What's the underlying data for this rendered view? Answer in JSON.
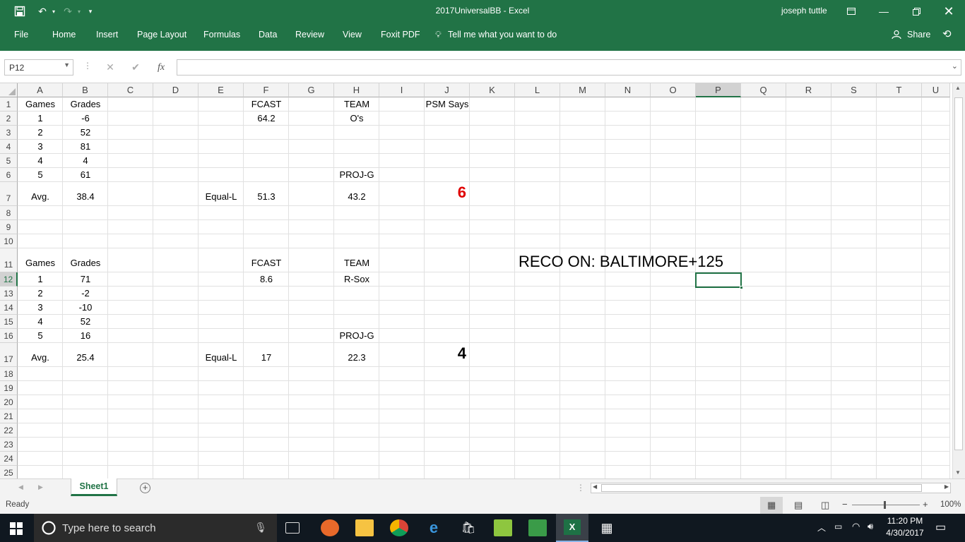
{
  "window": {
    "title": "2017UniversalBB  -  Excel",
    "user": "joseph tuttle"
  },
  "ribbon": {
    "tabs": [
      "File",
      "Home",
      "Insert",
      "Page Layout",
      "Formulas",
      "Data",
      "Review",
      "View",
      "Foxit PDF"
    ],
    "tell_me": "Tell me what you want to do",
    "share": "Share"
  },
  "formula_bar": {
    "name_box": "P12",
    "fx": "fx",
    "content": ""
  },
  "columns": [
    "A",
    "B",
    "C",
    "D",
    "E",
    "F",
    "G",
    "H",
    "I",
    "J",
    "K",
    "L",
    "M",
    "N",
    "O",
    "P",
    "Q",
    "R",
    "S",
    "T",
    "U"
  ],
  "rows": [
    "1",
    "2",
    "3",
    "4",
    "5",
    "6",
    "7",
    "8",
    "9",
    "10",
    "11",
    "12",
    "13",
    "14",
    "15",
    "16",
    "17",
    "18",
    "19",
    "20",
    "21",
    "22",
    "23",
    "24",
    "25"
  ],
  "cells": {
    "A1": "Games",
    "B1": "Grades",
    "F1": "FCAST",
    "H1": "TEAM",
    "J1": "PSM Says",
    "A2": "1",
    "B2": "-6",
    "F2": "64.2",
    "H2": "O's",
    "A3": "2",
    "B3": "52",
    "A4": "3",
    "B4": "81",
    "A5": "4",
    "B5": "4",
    "A6": "5",
    "B6": "61",
    "H6": "PROJ-G",
    "A7": "Avg.",
    "B7": "38.4",
    "E7": "Equal-L",
    "F7": "51.3",
    "H7": "43.2",
    "J7": "6",
    "A11": "Games",
    "B11": "Grades",
    "F11": "FCAST",
    "H11": "TEAM",
    "A12": "1",
    "B12": "71",
    "F12": "8.6",
    "H12": "R-Sox",
    "A13": "2",
    "B13": "-2",
    "A14": "3",
    "B14": "-10",
    "A15": "4",
    "B15": "52",
    "A16": "5",
    "B16": "16",
    "H16": "PROJ-G",
    "A17": "Avg.",
    "B17": "25.4",
    "E17": "Equal-L",
    "F17": "17",
    "H17": "22.3",
    "J17": "4"
  },
  "reco_text": "RECO ON: BALTIMORE+125",
  "accent_color": "#217346",
  "highlight_color": "#e00000",
  "sheet_tab": "Sheet1",
  "status": {
    "ready": "Ready",
    "zoom": "100%"
  },
  "taskbar": {
    "search_placeholder": "Type here to search",
    "time": "11:20 PM",
    "date": "4/30/2017"
  }
}
